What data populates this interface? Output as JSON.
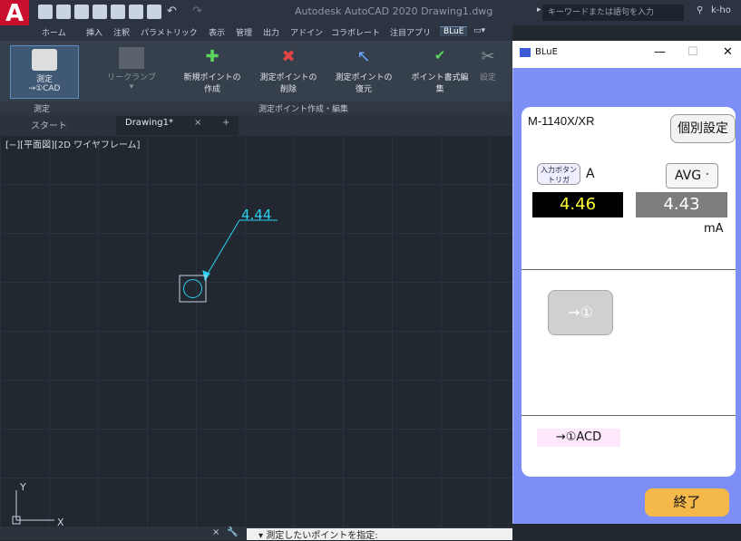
{
  "app": {
    "title": "Autodesk AutoCAD 2020   Drawing1.dwg",
    "search_placeholder": "キーワードまたは語句を入力",
    "user": "k-ho"
  },
  "menu_tabs": [
    "ホーム",
    "挿入",
    "注釈",
    "パラメトリック",
    "表示",
    "管理",
    "出力",
    "アドイン",
    "コラボレート",
    "注目アプリ",
    "BLuE"
  ],
  "ribbon": {
    "measure_label": "測定\n→①CAD",
    "clamp_label": "リークランプ",
    "new_point": "新規ポイントの作成",
    "delete_point": "測定ポイントの削除",
    "restore_point": "測定ポイントの復元",
    "format_edit": "ポイント書式編集",
    "settings": "設定",
    "panel_measure": "測定",
    "panel_edit": "測定ポイント作成・編集"
  },
  "doc_tabs": {
    "start": "スタート",
    "drawing": "Drawing1*",
    "close": "×",
    "add": "+"
  },
  "viewport_label": "[−][平面図][2D ワイヤフレーム]",
  "canvas_annotation": "4.44",
  "command": {
    "prompt": "▾ 測定したいポイントを指定:"
  },
  "dialog": {
    "title": "BLuE",
    "model": "M-1140X/XR",
    "settings_button": "個別設定",
    "trigger_button": "入力ボタン\nトリガ",
    "unit_a": "A",
    "avg_option": "AVG",
    "value_main": "4.46",
    "value_avg": "4.43",
    "unit_ma": "mA",
    "to_cad_button": "→①",
    "acd_label": "→①ACD",
    "exit_button": "終了"
  },
  "colors": {
    "accent_blue": "#7d8ef6",
    "value_yellow": "#ffff33",
    "exit_orange": "#f5b84a",
    "annotation_cyan": "#2bd1f1"
  }
}
